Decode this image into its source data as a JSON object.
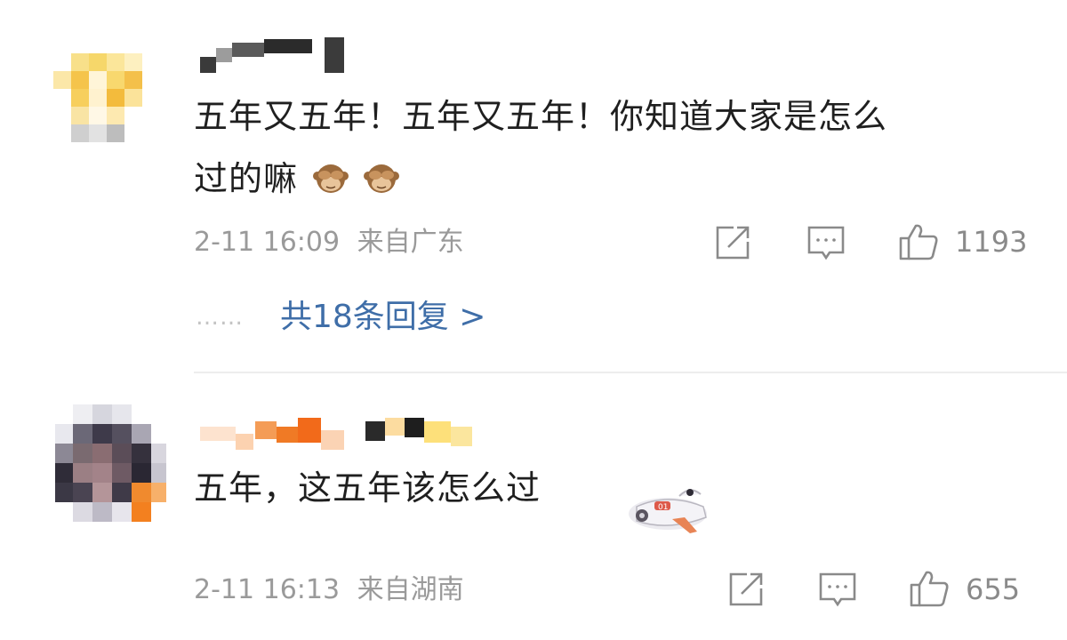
{
  "comments": [
    {
      "text_line1": "五年又五年！五年又五年！你知道大家是怎么",
      "text_line2": "过的嘛",
      "emojis": [
        "see-no-evil-monkey",
        "see-no-evil-monkey"
      ],
      "timestamp": "2-11 16:09",
      "location": "来自广东",
      "likes": "1193",
      "replies_label": "共18条回复 >",
      "replies_dots": "……"
    },
    {
      "text_line1": "五年，这五年该怎么过",
      "sticker": "airplane-sticker",
      "timestamp": "2-11 16:13",
      "location": "来自湖南",
      "likes": "655"
    }
  ],
  "icons": [
    "share-icon",
    "comment-icon",
    "like-icon"
  ],
  "colors": {
    "text": "#1f1f1f",
    "meta": "#9a9a9a",
    "link": "#3f6ea8",
    "divider": "#ededed"
  }
}
